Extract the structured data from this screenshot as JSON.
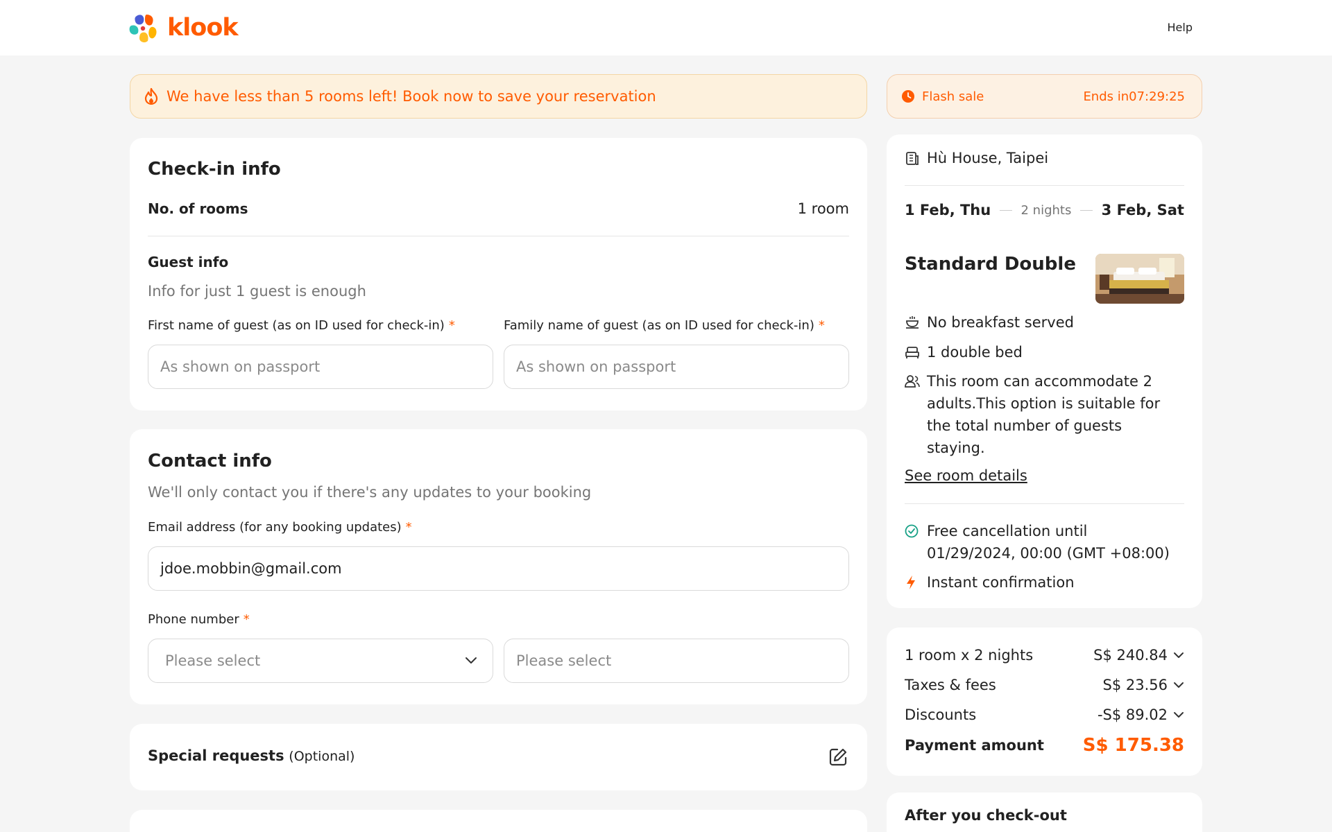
{
  "header": {
    "logo_text": "klook",
    "help": "Help"
  },
  "alert": {
    "text": "We have less than 5 rooms left! Book now to save your reservation"
  },
  "flash_sale": {
    "label": "Flash sale",
    "ends": "Ends in07:29:25"
  },
  "checkin": {
    "title": "Check-in info",
    "rooms_label": "No. of rooms",
    "rooms_value": "1 room",
    "guest_title": "Guest info",
    "guest_sub": "Info for just 1 guest is enough",
    "first_name_label": "First name of guest (as on ID used for check-in)",
    "family_name_label": "Family name of guest (as on ID used for check-in)",
    "required_mark": "*",
    "first_name_placeholder": "As shown on passport",
    "family_name_placeholder": "As shown on passport"
  },
  "contact": {
    "title": "Contact info",
    "sub": "We'll only contact you if there's any updates to your booking",
    "email_label": "Email address (for any booking updates)",
    "email_value": "jdoe.mobbin@gmail.com",
    "phone_label": "Phone number",
    "country_code_placeholder": "Please select",
    "phone_placeholder": "Please select"
  },
  "special": {
    "title": "Special requests",
    "optional": "(Optional)"
  },
  "summary": {
    "hotel": "Hù House, Taipei",
    "checkin_date": "1 Feb, Thu",
    "nights": "2 nights",
    "checkout_date": "3 Feb, Sat",
    "room_name": "Standard Double",
    "breakfast": "No breakfast served",
    "bed": "1 double bed",
    "occupancy": "This room can accommodate 2 adults.This option is suitable for the total number of guests staying.",
    "see_details": "See room details",
    "cancellation": "Free cancellation until 01/29/2024, 00:00 (GMT +08:00)",
    "instant": "Instant confirmation"
  },
  "pricing": {
    "rows": [
      {
        "label": "1 room x 2 nights",
        "value": "S$ 240.84"
      },
      {
        "label": "Taxes & fees",
        "value": "S$ 23.56"
      },
      {
        "label": "Discounts",
        "value": "-S$ 89.02"
      }
    ],
    "payment_label": "Payment amount",
    "payment_value": "S$ 175.38"
  },
  "after": {
    "title": "After you check-out"
  },
  "colors": {
    "brand": "#ff5b00",
    "page_bg": "#f5f5f5",
    "alert_bg": "#fdf1dd",
    "success": "#16a085"
  }
}
